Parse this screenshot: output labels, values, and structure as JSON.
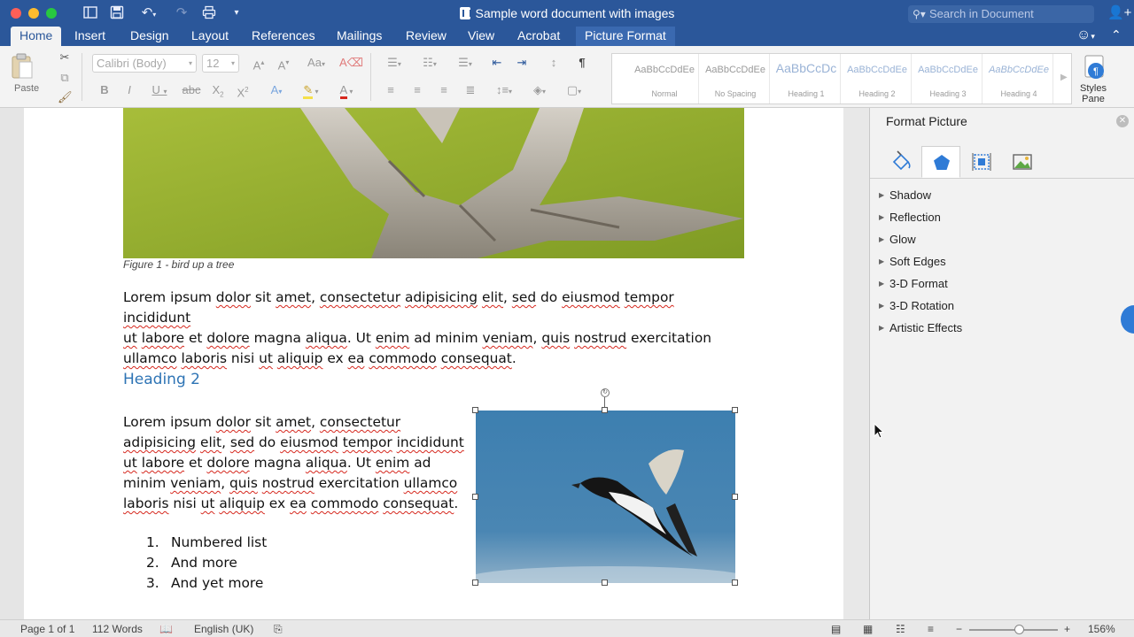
{
  "window": {
    "title": "Sample word document with images",
    "search_placeholder": "Search in Document"
  },
  "tabs": [
    {
      "label": "Home"
    },
    {
      "label": "Insert"
    },
    {
      "label": "Design"
    },
    {
      "label": "Layout"
    },
    {
      "label": "References"
    },
    {
      "label": "Mailings"
    },
    {
      "label": "Review"
    },
    {
      "label": "View"
    },
    {
      "label": "Acrobat"
    },
    {
      "label": "Picture Format"
    }
  ],
  "active_tab": "Home",
  "ribbon": {
    "paste_label": "Paste",
    "font_name": "Calibri (Body)",
    "font_size": "12",
    "styles": [
      {
        "preview": "AaBbCcDdEe",
        "name": "Normal"
      },
      {
        "preview": "AaBbCcDdEe",
        "name": "No Spacing"
      },
      {
        "preview": "AaBbCcDc",
        "name": "Heading 1"
      },
      {
        "preview": "AaBbCcDdEe",
        "name": "Heading 2"
      },
      {
        "preview": "AaBbCcDdEe",
        "name": "Heading 3"
      },
      {
        "preview": "AaBbCcDdEe",
        "name": "Heading 4"
      }
    ],
    "styles_pane_label": "Styles Pane",
    "accent_color": "#2b579a"
  },
  "document": {
    "caption": "Figure 1 - bird up a tree",
    "heading": "Heading 2",
    "list": [
      {
        "num": "1.",
        "text": "Numbered list"
      },
      {
        "num": "2.",
        "text": "And more"
      },
      {
        "num": "3.",
        "text": "And yet more"
      }
    ]
  },
  "format_pane": {
    "title": "Format Picture",
    "tabs": [
      {
        "icon": "fill-bucket-icon"
      },
      {
        "icon": "pentagon-effects-icon",
        "selected": true
      },
      {
        "icon": "size-layout-icon"
      },
      {
        "icon": "picture-icon"
      }
    ],
    "sections": [
      {
        "label": "Shadow"
      },
      {
        "label": "Reflection"
      },
      {
        "label": "Glow"
      },
      {
        "label": "Soft Edges"
      },
      {
        "label": "3-D Format"
      },
      {
        "label": "3-D Rotation"
      },
      {
        "label": "Artistic Effects"
      }
    ]
  },
  "status": {
    "page": "Page 1 of 1",
    "words": "112 Words",
    "language": "English (UK)",
    "zoom": "156%",
    "zoom_fraction": 0.56
  }
}
